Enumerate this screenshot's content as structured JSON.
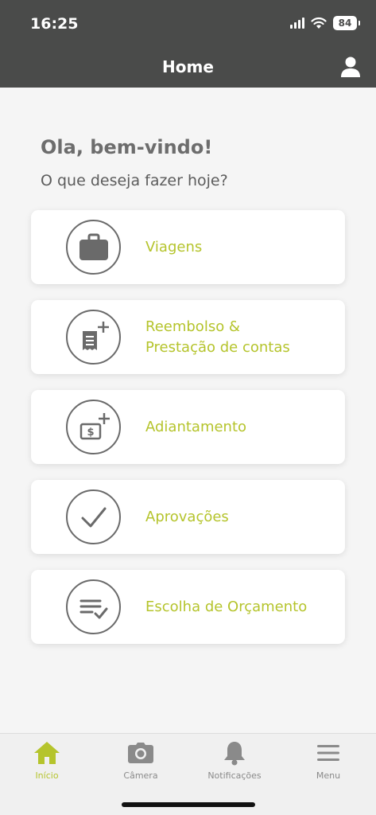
{
  "status": {
    "time": "16:25",
    "battery": "84"
  },
  "header": {
    "title": "Home"
  },
  "greeting": {
    "title": "Ola, bem-vindo!",
    "subtitle": "O que deseja fazer hoje?"
  },
  "menu": [
    {
      "label": "Viagens",
      "icon": "briefcase-icon"
    },
    {
      "label": "Reembolso &\nPrestação de contas",
      "icon": "receipt-add-icon"
    },
    {
      "label": "Adiantamento",
      "icon": "money-add-icon"
    },
    {
      "label": "Aprovações",
      "icon": "checkmark-icon"
    },
    {
      "label": "Escolha de Orçamento",
      "icon": "checklist-icon"
    }
  ],
  "tabs": [
    {
      "label": "Início",
      "icon": "home-icon",
      "active": true
    },
    {
      "label": "Câmera",
      "icon": "camera-icon",
      "active": false
    },
    {
      "label": "Notificações",
      "icon": "bell-icon",
      "active": false
    },
    {
      "label": "Menu",
      "icon": "hamburger-icon",
      "active": false
    }
  ],
  "colors": {
    "accent": "#b5c42c",
    "header": "#4a4b4a",
    "icon": "#6a6a6a"
  }
}
